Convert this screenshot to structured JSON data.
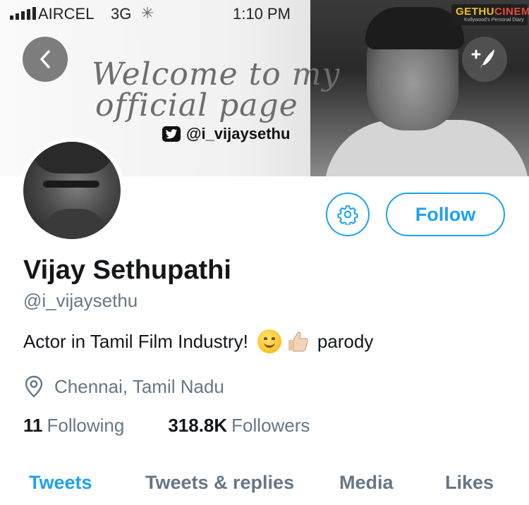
{
  "status_bar": {
    "carrier": "AIRCEL",
    "network": "3G",
    "time": "1:10 PM"
  },
  "watermark": {
    "brand_left": "GETHU",
    "brand_right": "CINEMA",
    "tagline": "Kollywood's Personal Diary"
  },
  "header": {
    "back_icon": "chevron-left-icon",
    "compose_icon": "compose-tweet-icon",
    "banner_line_1": "Welcome to my",
    "banner_line_2": "official page",
    "banner_handle": "@i_vijaysethu"
  },
  "profile": {
    "display_name": "Vijay Sethupathi",
    "username": "@i_vijaysethu",
    "bio_text": "Actor in Tamil Film Industry!",
    "bio_emojis": [
      "smiling-face",
      "thumbs-up"
    ],
    "bio_suffix": "parody",
    "location": "Chennai, Tamil Nadu",
    "following_count": "11",
    "following_label": "Following",
    "followers_count": "318.8K",
    "followers_label": "Followers"
  },
  "actions": {
    "settings_icon": "gear-icon",
    "follow_label": "Follow"
  },
  "tabs": [
    {
      "label": "Tweets",
      "active": true
    },
    {
      "label": "Tweets & replies",
      "active": false
    },
    {
      "label": "Media",
      "active": false
    },
    {
      "label": "Likes",
      "active": false
    }
  ],
  "colors": {
    "accent": "#1da1f2",
    "secondary_text": "#657786",
    "primary_text": "#14171a"
  }
}
